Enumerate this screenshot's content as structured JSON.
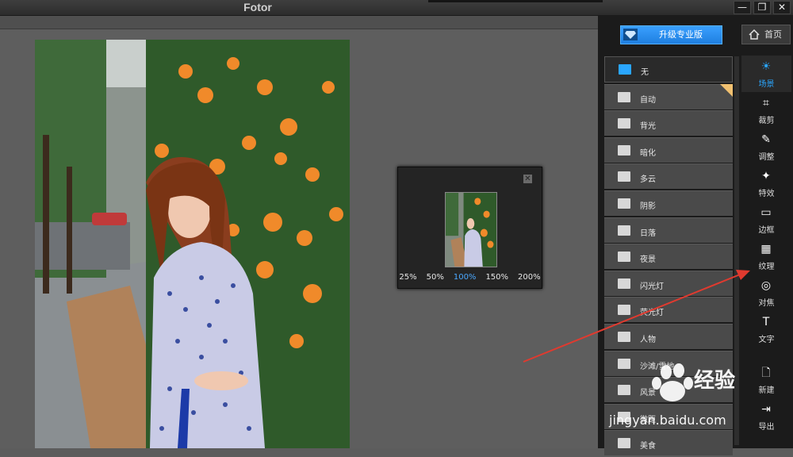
{
  "window": {
    "title": "Fotor",
    "minimize": "—",
    "restore": "❐",
    "close": "✕"
  },
  "header": {
    "upgrade_label": "升级专业版",
    "home_label": "首页"
  },
  "navigator": {
    "close": "✕",
    "zoom_levels": [
      "25%",
      "50%",
      "100%",
      "150%",
      "200%"
    ],
    "active_zoom": "100%"
  },
  "scenes": [
    {
      "label": "无",
      "icon": "none-icon",
      "selected": true
    },
    {
      "label": "自动",
      "icon": "camera-icon",
      "premium": true
    },
    {
      "label": "背光",
      "icon": "backlight-icon"
    },
    {
      "label": "暗化",
      "icon": "darken-icon"
    },
    {
      "label": "多云",
      "icon": "cloudy-icon"
    },
    {
      "label": "阴影",
      "icon": "shadow-icon"
    },
    {
      "label": "日落",
      "icon": "sunset-icon"
    },
    {
      "label": "夜景",
      "icon": "night-icon"
    },
    {
      "label": "闪光灯",
      "icon": "flash-icon"
    },
    {
      "label": "荧光灯",
      "icon": "fluorescent-icon"
    },
    {
      "label": "人物",
      "icon": "portrait-icon"
    },
    {
      "label": "沙滩/雪地",
      "icon": "beach-icon"
    },
    {
      "label": "风景",
      "icon": "landscape-icon"
    },
    {
      "label": "微距",
      "icon": "macro-icon"
    },
    {
      "label": "美食",
      "icon": "food-icon"
    }
  ],
  "tools": [
    {
      "label": "场景",
      "icon": "sun-icon",
      "glyph": "☀",
      "active": true
    },
    {
      "label": "裁剪",
      "icon": "crop-icon",
      "glyph": "⌗"
    },
    {
      "label": "调整",
      "icon": "pencil-icon",
      "glyph": "✎"
    },
    {
      "label": "特效",
      "icon": "sparkle-icon",
      "glyph": "✦"
    },
    {
      "label": "边框",
      "icon": "frame-icon",
      "glyph": "▭"
    },
    {
      "label": "纹理",
      "icon": "texture-icon",
      "glyph": "▦"
    },
    {
      "label": "对焦",
      "icon": "focus-icon",
      "glyph": "◎"
    },
    {
      "label": "文字",
      "icon": "text-icon",
      "glyph": "T"
    }
  ],
  "tools_bottom": [
    {
      "label": "新建",
      "icon": "new-file-icon",
      "glyph": "🗋"
    },
    {
      "label": "导出",
      "icon": "export-icon",
      "glyph": "⇥"
    }
  ],
  "watermark": {
    "line1": "经验",
    "line2": "jingyan.baidu.com"
  },
  "colors": {
    "accent": "#2aa6ff",
    "annotation": "#e03a2f"
  }
}
